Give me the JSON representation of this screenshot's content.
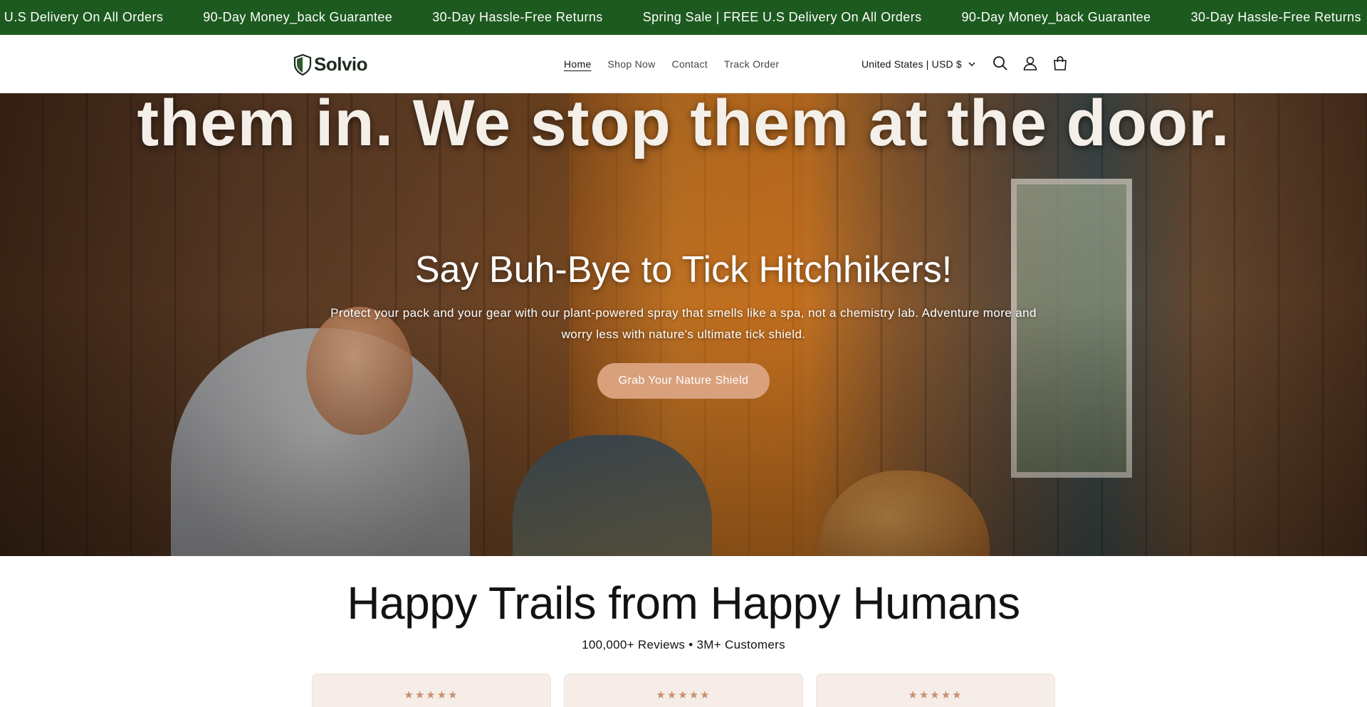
{
  "announcement": {
    "items": [
      "E U.S Delivery On All Orders",
      "90-Day Money_back Guarantee",
      "30-Day Hassle-Free Returns",
      "Spring Sale | FREE U.S Delivery On All Orders",
      "90-Day Money_back Guarantee",
      "30-Day Hassle-Free Returns"
    ],
    "bg_color": "#1d5a1f"
  },
  "header": {
    "logo_text": "Solvio",
    "nav": [
      "Home",
      "Shop Now",
      "Contact",
      "Track Order"
    ],
    "active_nav": "Home",
    "locale": "United States | USD $",
    "icons": [
      "search-icon",
      "account-icon",
      "cart-icon"
    ]
  },
  "hero": {
    "overlay_text": "them in. We stop them at the door.",
    "title": "Say Buh-Bye to Tick Hitchhikers!",
    "subtitle": "Protect your pack and your gear with our plant-powered spray that smells like a spa, not a chemistry lab. Adventure more and worry less with nature's ultimate tick shield.",
    "cta_label": "Grab Your Nature Shield",
    "cta_color": "#d9a07c"
  },
  "reviews": {
    "title": "Happy Trails from Happy Humans",
    "subtitle": "100,000+ Reviews • 3M+ Customers",
    "cards": [
      {
        "stars": "★★★★★"
      },
      {
        "stars": "★★★★★"
      },
      {
        "stars": "★★★★★"
      }
    ]
  }
}
